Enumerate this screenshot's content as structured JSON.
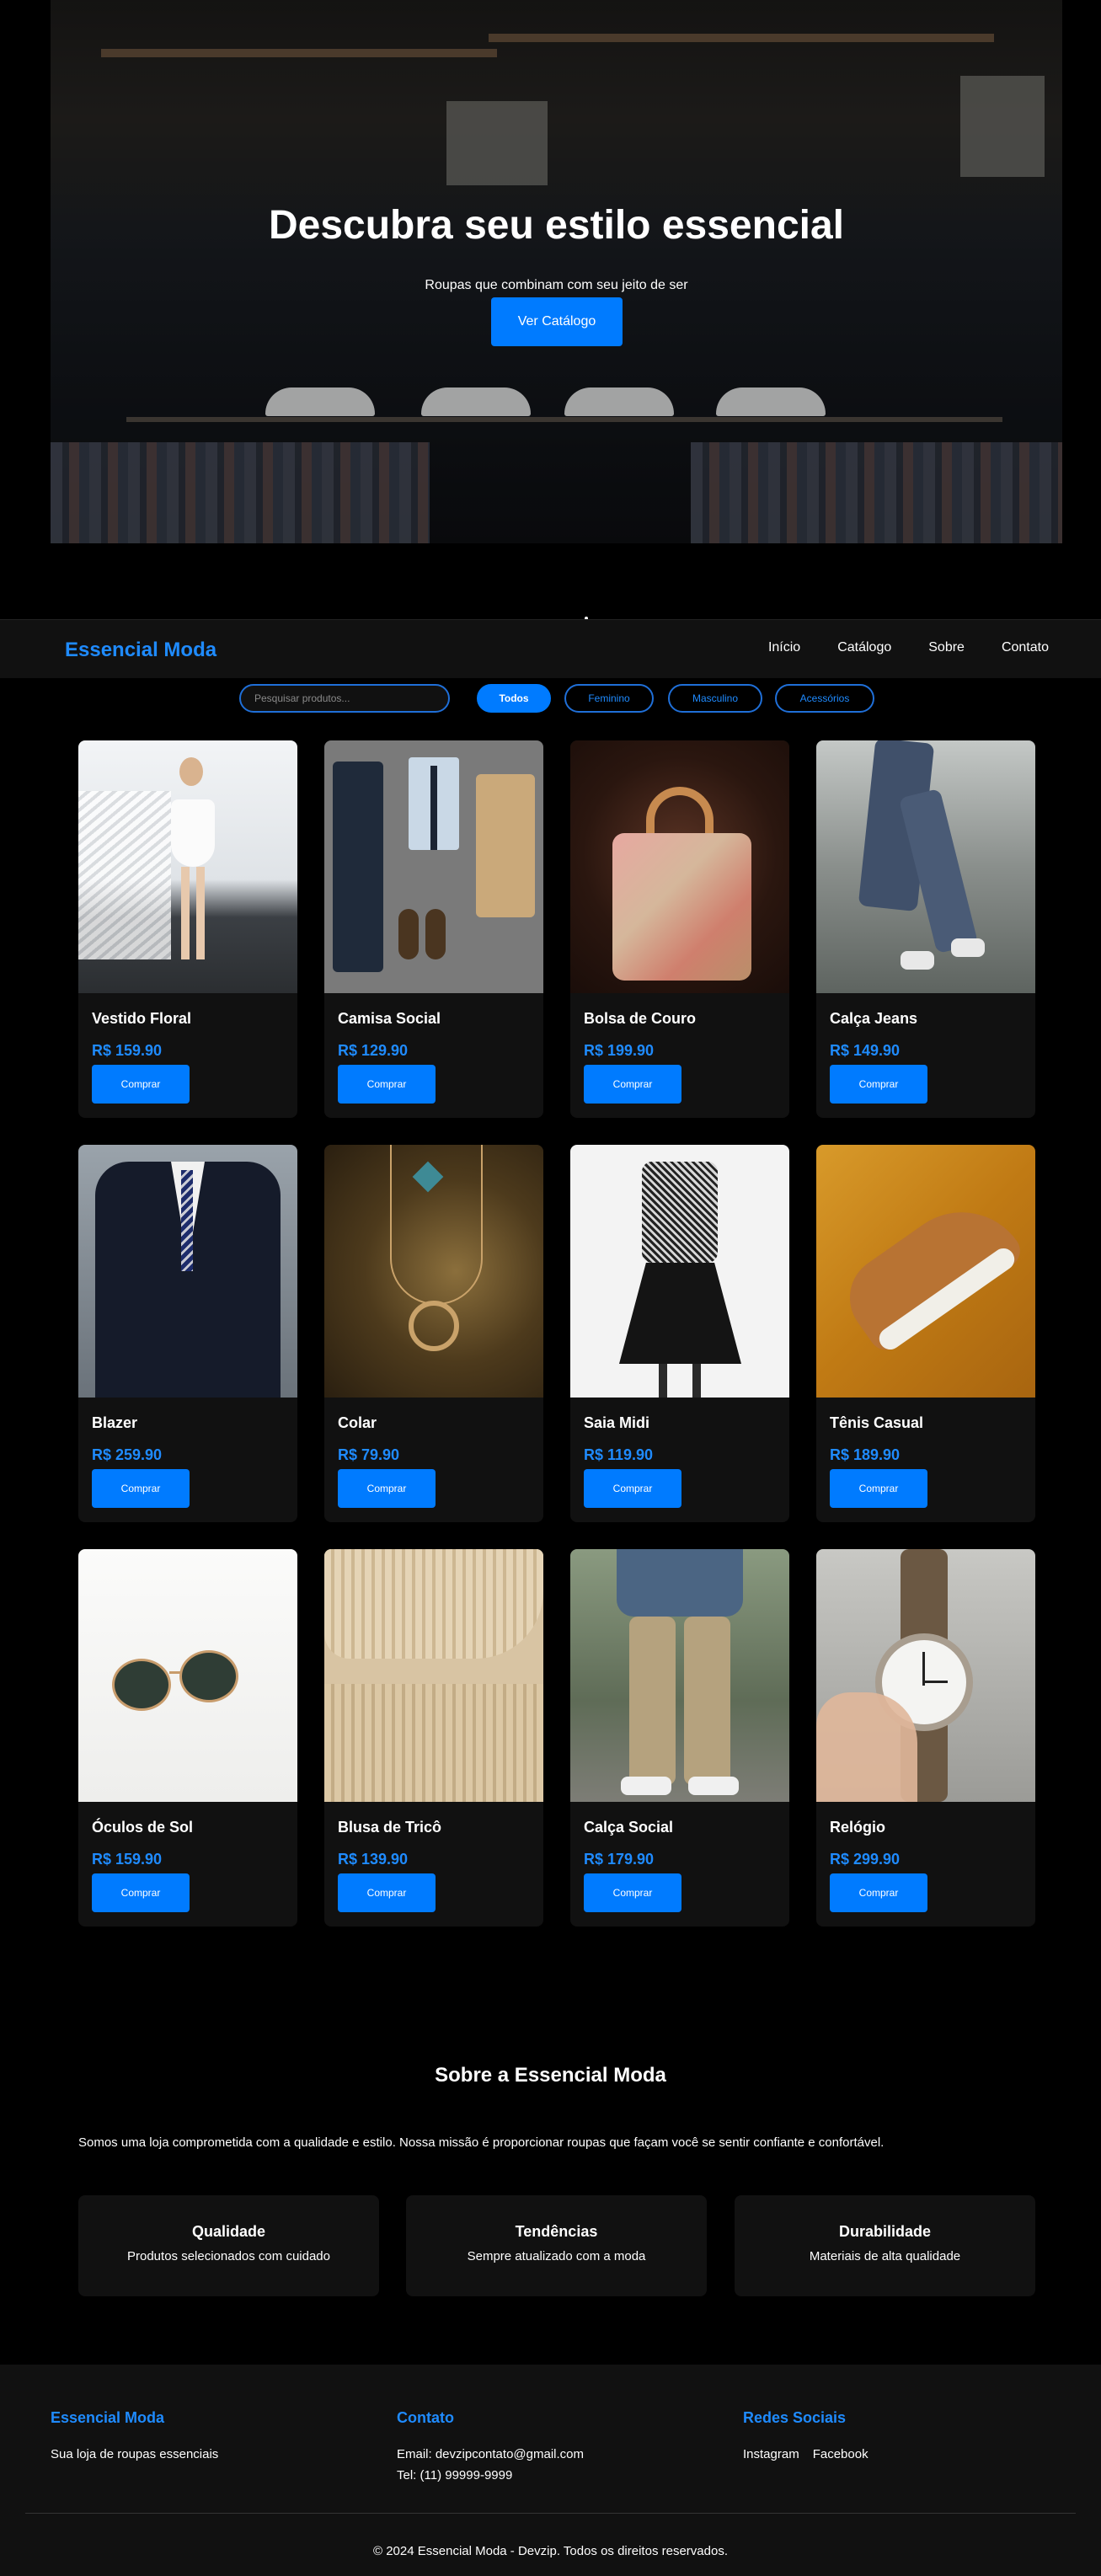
{
  "hero": {
    "title": "Descubra seu estilo essencial",
    "subtitle": "Roupas que combinam com seu jeito de ser",
    "cta": "Ver Catálogo"
  },
  "nav": {
    "brand": "Essencial Moda",
    "links": [
      "Início",
      "Catálogo",
      "Sobre",
      "Contato"
    ]
  },
  "filters": {
    "search_placeholder": "Pesquisar produtos...",
    "categories": [
      "Todos",
      "Feminino",
      "Masculino",
      "Acessórios"
    ],
    "active": "Todos"
  },
  "products": [
    {
      "name": "Vestido Floral",
      "price": "R$ 159.90",
      "button": "Comprar"
    },
    {
      "name": "Camisa Social",
      "price": "R$ 129.90",
      "button": "Comprar"
    },
    {
      "name": "Bolsa de Couro",
      "price": "R$ 199.90",
      "button": "Comprar"
    },
    {
      "name": "Calça Jeans",
      "price": "R$ 149.90",
      "button": "Comprar"
    },
    {
      "name": "Blazer",
      "price": "R$ 259.90",
      "button": "Comprar"
    },
    {
      "name": "Colar",
      "price": "R$ 79.90",
      "button": "Comprar"
    },
    {
      "name": "Saia Midi",
      "price": "R$ 119.90",
      "button": "Comprar"
    },
    {
      "name": "Tênis Casual",
      "price": "R$ 189.90",
      "button": "Comprar"
    },
    {
      "name": "Óculos de Sol",
      "price": "R$ 159.90",
      "button": "Comprar"
    },
    {
      "name": "Blusa de Tricô",
      "price": "R$ 139.90",
      "button": "Comprar"
    },
    {
      "name": "Calça Social",
      "price": "R$ 179.90",
      "button": "Comprar"
    },
    {
      "name": "Relógio",
      "price": "R$ 299.90",
      "button": "Comprar"
    }
  ],
  "about": {
    "title": "Sobre a Essencial Moda",
    "text": "Somos uma loja comprometida com a qualidade e estilo. Nossa missão é proporcionar roupas que façam você se sentir confiante e confortável.",
    "features": [
      {
        "title": "Qualidade",
        "desc": "Produtos selecionados com cuidado"
      },
      {
        "title": "Tendências",
        "desc": "Sempre atualizado com a moda"
      },
      {
        "title": "Durabilidade",
        "desc": "Materiais de alta qualidade"
      }
    ]
  },
  "footer": {
    "brand_title": "Essencial Moda",
    "brand_text": "Sua loja de roupas essenciais",
    "contact_title": "Contato",
    "email": "Email: devzipcontato@gmail.com",
    "phone": "Tel: (11) 99999-9999",
    "social_title": "Redes Sociais",
    "social": [
      "Instagram",
      "Facebook"
    ],
    "copyright": "© 2024 Essencial Moda - Devzip. Todos os direitos reservados."
  },
  "colors": {
    "accent": "#007bff",
    "link_blue": "#1f8bff",
    "card_bg": "#111111",
    "page_bg": "#000000"
  }
}
